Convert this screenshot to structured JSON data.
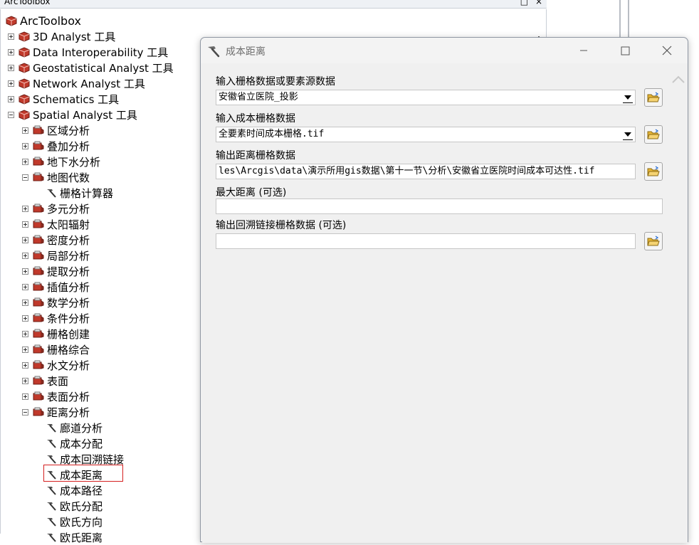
{
  "toolbox": {
    "window_title": "ArcToolbox",
    "root_label": "ArcToolbox",
    "toolsets": [
      {
        "label": "3D Analyst 工具",
        "expanded": false
      },
      {
        "label": "Data Interoperability 工具",
        "expanded": false
      },
      {
        "label": "Geostatistical Analyst 工具",
        "expanded": false
      },
      {
        "label": "Network Analyst 工具",
        "expanded": false
      },
      {
        "label": "Schematics 工具",
        "expanded": false
      },
      {
        "label": "Spatial Analyst 工具",
        "expanded": true
      }
    ],
    "spatial_analyst_children": [
      {
        "label": "区域分析",
        "expanded": false
      },
      {
        "label": "叠加分析",
        "expanded": false
      },
      {
        "label": "地下水分析",
        "expanded": false
      },
      {
        "label": "地图代数",
        "expanded": true
      },
      {
        "label": "栅格计算器",
        "is_tool": true
      },
      {
        "label": "多元分析",
        "expanded": false
      },
      {
        "label": "太阳辐射",
        "expanded": false
      },
      {
        "label": "密度分析",
        "expanded": false
      },
      {
        "label": "局部分析",
        "expanded": false
      },
      {
        "label": "提取分析",
        "expanded": false
      },
      {
        "label": "插值分析",
        "expanded": false
      },
      {
        "label": "数学分析",
        "expanded": false
      },
      {
        "label": "条件分析",
        "expanded": false
      },
      {
        "label": "栅格创建",
        "expanded": false
      },
      {
        "label": "栅格综合",
        "expanded": false
      },
      {
        "label": "水文分析",
        "expanded": false
      },
      {
        "label": "表面",
        "expanded": false
      },
      {
        "label": "表面分析",
        "expanded": false
      },
      {
        "label": "距离分析",
        "expanded": true
      }
    ],
    "distance_tools": [
      {
        "label": "廊道分析"
      },
      {
        "label": "成本分配"
      },
      {
        "label": "成本回溯链接"
      },
      {
        "label": "成本距离",
        "highlighted": true
      },
      {
        "label": "成本路径"
      },
      {
        "label": "欧氏分配"
      },
      {
        "label": "欧氏方向"
      },
      {
        "label": "欧氏距离"
      }
    ]
  },
  "dialog": {
    "title": "成本距离",
    "params": [
      {
        "label": "输入栅格数据或要素源数据",
        "value": "安徽省立医院_投影",
        "type": "dropdown"
      },
      {
        "label": "输入成本栅格数据",
        "value": "全要素时间成本栅格.tif",
        "type": "dropdown"
      },
      {
        "label": "输出距离栅格数据",
        "value": "les\\Arcgis\\data\\演示所用gis数据\\第十一节\\分析\\安徽省立医院时间成本可达性.tif",
        "type": "path"
      },
      {
        "label": "最大距离 (可选)",
        "value": "",
        "type": "text"
      },
      {
        "label": "输出回溯链接栅格数据 (可选)",
        "value": "",
        "type": "path"
      }
    ]
  },
  "colors": {
    "highlight": "#d42020",
    "dialog_bg": "#f0f0f0",
    "folder_yellow": "#e8b634",
    "toolbox_red": "#c0392b"
  }
}
